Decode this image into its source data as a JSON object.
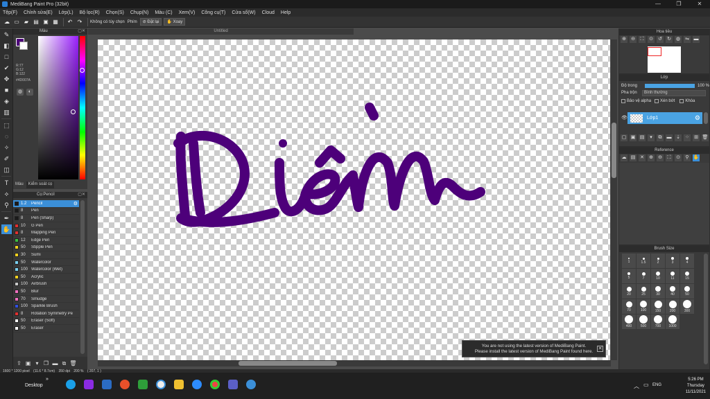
{
  "window": {
    "title": "MediBang Paint Pro (32bit)",
    "controls": [
      "—",
      "❐",
      "✕"
    ]
  },
  "menu": [
    "Tệp(F)",
    "Chỉnh sửa(E)",
    "Lớp(L)",
    "Bộ lọc(R)",
    "Chọn(S)",
    "Chụp(N)",
    "Màu (C)",
    "Xem(V)",
    "Công cụ(T)",
    "Cửa sổ(W)",
    "Cloud",
    "Help"
  ],
  "toolbar": {
    "custom": "Không có tùy chọn",
    "keys_label": "Phím",
    "reset": "Đặt lại",
    "rotate": "Xoay"
  },
  "color_panel": {
    "title": "Màu",
    "rgb": [
      "R:77",
      "G:12",
      "B:122"
    ],
    "hex": "#4D007A",
    "fg": "#4d007a",
    "bg": "#ffffff",
    "tabs": [
      "Màu",
      "Kiểm soát cọ"
    ]
  },
  "brush_panel": {
    "title": "Cọ:Pencil",
    "brushes": [
      {
        "size": "1.2",
        "name": "Pencil",
        "color": "#1a1a1a",
        "selected": true
      },
      {
        "size": "8",
        "name": "Pen",
        "color": "#1a1a1a"
      },
      {
        "size": "8",
        "name": "Pen (Sharp)",
        "color": "#1a1a1a"
      },
      {
        "size": "10",
        "name": "G Pen",
        "color": "#e03030"
      },
      {
        "size": "8",
        "name": "Mapping Pen",
        "color": "#e03030"
      },
      {
        "size": "12",
        "name": "Edge Pen",
        "color": "#3cc040"
      },
      {
        "size": "50",
        "name": "Stipple Pen",
        "color": "#f0d020"
      },
      {
        "size": "30",
        "name": "Sumi",
        "color": "#f0d020"
      },
      {
        "size": "50",
        "name": "Watercolor",
        "color": "#7ad0f0"
      },
      {
        "size": "100",
        "name": "Watercolor (Wet)",
        "color": "#7ad0f0"
      },
      {
        "size": "50",
        "name": "Acrylic",
        "color": "#f0d020"
      },
      {
        "size": "100",
        "name": "Airbrush",
        "color": "#c8c8c8"
      },
      {
        "size": "50",
        "name": "Blur",
        "color": "#f070c0"
      },
      {
        "size": "70",
        "name": "Smudge",
        "color": "#f070c0"
      },
      {
        "size": "100",
        "name": "Sparkle Brush",
        "color": "#3050e0"
      },
      {
        "size": "8",
        "name": "Rotation Symmetry Pe",
        "color": "#e03030"
      },
      {
        "size": "50",
        "name": "Eraser (Soft)",
        "color": "#ffffff"
      },
      {
        "size": "50",
        "name": "Eraser",
        "color": "#ffffff"
      }
    ]
  },
  "document": {
    "tab": "Untitled",
    "stroke_color": "#4d007a"
  },
  "notice": {
    "line1": "You are not using the latest version of MediBang Paint.",
    "line2": "Please install the latest version of MediBang Paint found here."
  },
  "navigator": {
    "title": "Hoa tiêu"
  },
  "layers": {
    "title": "Lớp",
    "opacity_label": "Độ trong",
    "opacity_value": "100 %",
    "blend_label": "Pha trộn",
    "blend_value": "Bình thường",
    "protect_alpha": "Bảo vệ alpha",
    "clipping": "Xén bớt",
    "lock": "Khóa",
    "layer_name": "Lớp1"
  },
  "reference": {
    "title": "Reference"
  },
  "brush_size": {
    "title": "Brush Size",
    "sizes": [
      "1",
      "1.5",
      "2",
      "3",
      "4",
      "5",
      "7",
      "10",
      "11",
      "15",
      "20",
      "25",
      "30",
      "40",
      "50",
      "70",
      "100",
      "150",
      "200",
      "300",
      "400",
      "500",
      "700",
      "1000"
    ]
  },
  "status": {
    "pixels": "1600 * 1200 pixel",
    "cm": "(11.6 * 8.7cm)",
    "dpi": "350 dpi",
    "zoom": "200 %",
    "coord": "( 207, 1 )"
  },
  "taskbar": {
    "desktop": "Desktop",
    "lang": "ENG",
    "time": "5:26 PM",
    "day": "Thursday",
    "date": "11/11/2021"
  }
}
